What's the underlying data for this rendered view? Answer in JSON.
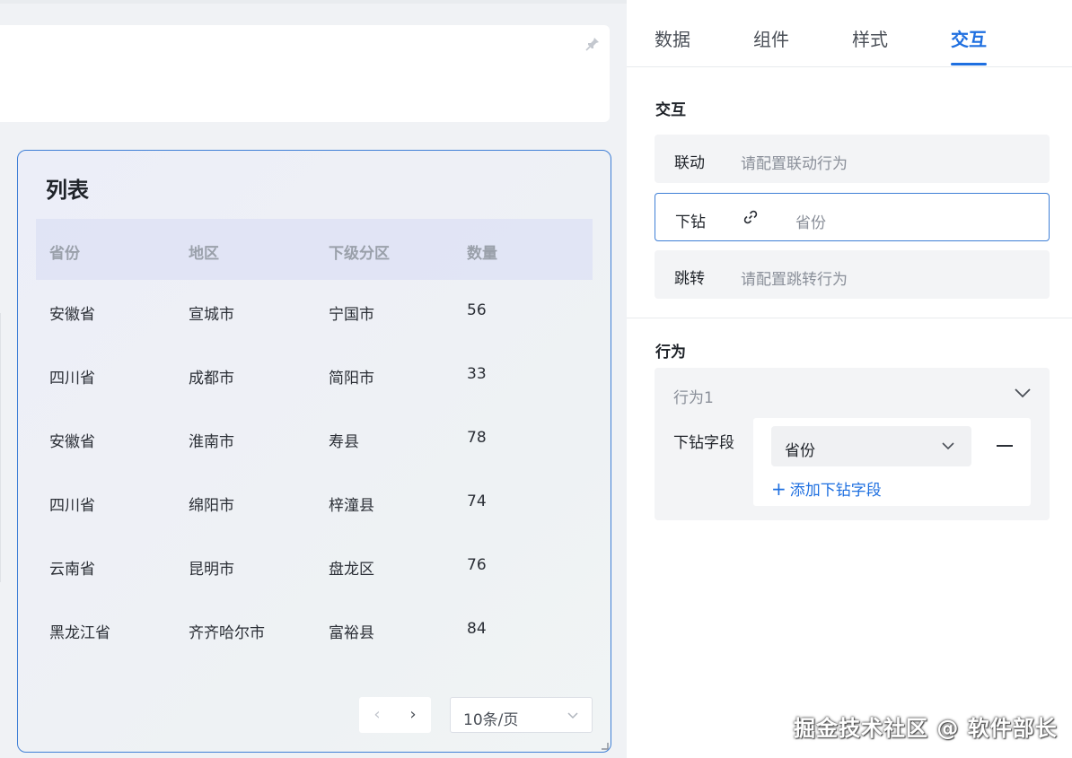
{
  "list": {
    "title": "列表",
    "columns": [
      "省份",
      "地区",
      "下级分区",
      "数量"
    ],
    "rows": [
      [
        "安徽省",
        "宣城市",
        "宁国市",
        "56"
      ],
      [
        "四川省",
        "成都市",
        "简阳市",
        "33"
      ],
      [
        "安徽省",
        "淮南市",
        "寿县",
        "78"
      ],
      [
        "四川省",
        "绵阳市",
        "梓潼县",
        "74"
      ],
      [
        "云南省",
        "昆明市",
        "盘龙区",
        "76"
      ],
      [
        "黑龙江省",
        "齐齐哈尔市",
        "富裕县",
        "84"
      ]
    ],
    "page_size": "10条/页"
  },
  "panel": {
    "tabs": [
      "数据",
      "组件",
      "样式",
      "交互"
    ],
    "active_tab": "交互",
    "interaction": {
      "title": "交互",
      "linkage": {
        "label": "联动",
        "value": "请配置联动行为"
      },
      "drill": {
        "label": "下钻",
        "value": "省份"
      },
      "jump": {
        "label": "跳转",
        "value": "请配置跳转行为"
      }
    },
    "behavior": {
      "title": "行为",
      "item_name": "行为1",
      "drill_field_label": "下钻字段",
      "selected_field": "省份",
      "add_field": "添加下钻字段"
    }
  },
  "watermark": "掘金技术社区 @ 软件部长",
  "colors": {
    "accent": "#1e6fe0",
    "selection_border": "#3f7fd6"
  }
}
